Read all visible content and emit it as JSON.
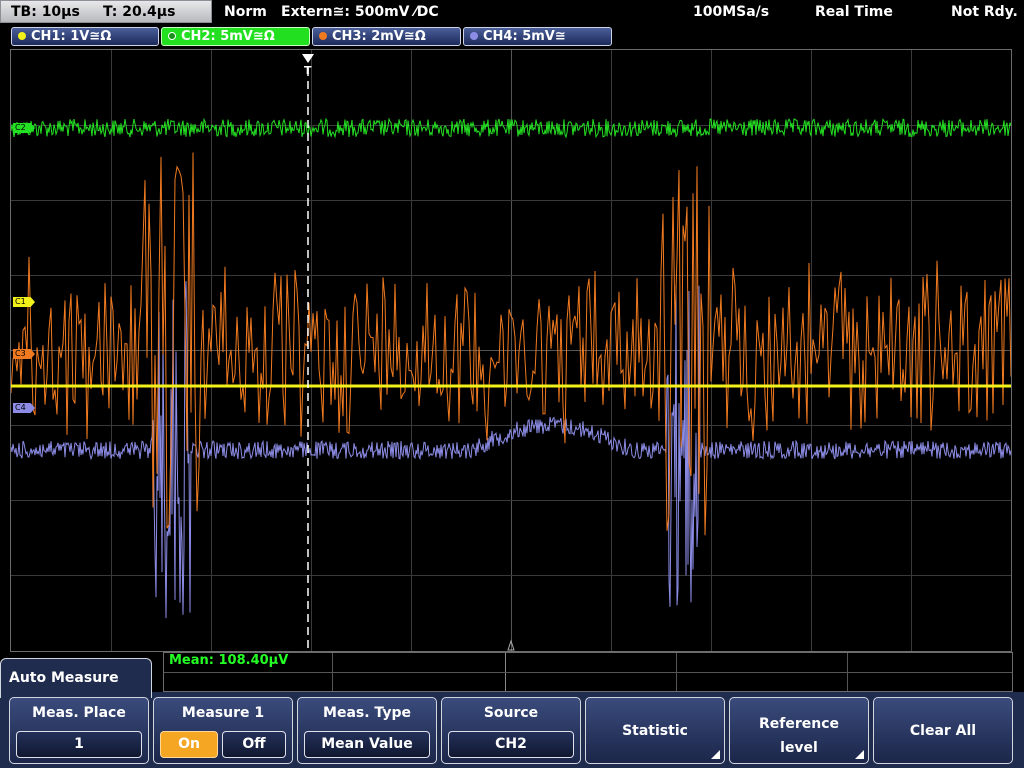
{
  "status": {
    "timebase": "TB: 10µs",
    "trigger_time": "T: 20.4µs",
    "mode": "Norm",
    "trigger_info": "Extern≅: 500mV ⁄DC",
    "sample_rate": "100MSa/s",
    "acq_mode": "Real Time",
    "state": "Not Rdy."
  },
  "channels": [
    {
      "label": "CH1: 1V≅Ω",
      "color": "#f2f21a",
      "active": false
    },
    {
      "label": "CH2: 5mV≅Ω",
      "color": "#24e022",
      "active": true
    },
    {
      "label": "CH3: 2mV≅Ω",
      "color": "#f07a20",
      "active": false
    },
    {
      "label": "CH4: 5mV≅",
      "color": "#8c8ce6",
      "active": false
    }
  ],
  "markers": {
    "c2": "C2",
    "c1": "C1",
    "c3": "C3",
    "c4": "C4",
    "trigger": "T"
  },
  "measurement": {
    "result": "Mean: 108.40µV"
  },
  "menu": {
    "title": "Auto Measure",
    "meas_place": {
      "label": "Meas. Place",
      "value": "1"
    },
    "measure1": {
      "label": "Measure 1",
      "on": "On",
      "off": "Off",
      "state": "On"
    },
    "meas_type": {
      "label": "Meas. Type",
      "value": "Mean Value"
    },
    "source": {
      "label": "Source",
      "value": "CH2"
    },
    "statistic": {
      "label": "Statistic"
    },
    "reference": {
      "label_line1": "Reference",
      "label_line2": "level"
    },
    "clear_all": {
      "label": "Clear All"
    }
  },
  "colors": {
    "ch1": "#f2f21a",
    "ch2": "#24e022",
    "ch3": "#f07a20",
    "ch4": "#8c8ce6",
    "grid": "#3a3a3a"
  }
}
